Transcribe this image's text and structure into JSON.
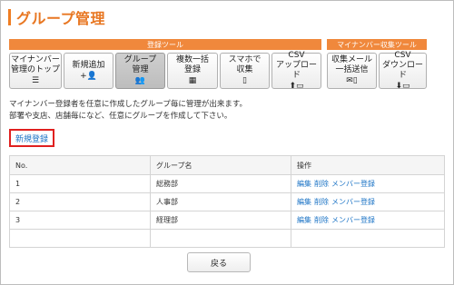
{
  "page": {
    "title": "グループ管理",
    "accent_color": "#ef7d22",
    "link_color": "#1c74c6",
    "highlight_color": "#e0201f"
  },
  "toolbar": {
    "registration_tools_label": "登録ツール",
    "mynumber_tools_label": "マイナンバー収集ツール",
    "buttons": [
      {
        "label": "マイナンバー\n管理のトップ",
        "icon": "list-icon",
        "glyph": "☰"
      },
      {
        "label": "新規追加",
        "icon": "add-user-icon",
        "glyph": "+👤"
      },
      {
        "label": "グループ\n管理",
        "icon": "users-icon",
        "glyph": "👥"
      },
      {
        "label": "複数一括\n登録",
        "icon": "grid-icon",
        "glyph": "▦"
      },
      {
        "label": "スマホで\n収集",
        "icon": "mobile-icon",
        "glyph": "▯"
      },
      {
        "label": "CSV\nアップロード",
        "icon": "upload-icon",
        "glyph": "⬆▭"
      },
      {
        "label": "収集メール\n一括送信",
        "icon": "mail-mobile-icon",
        "glyph": "✉▯"
      },
      {
        "label": "CSV\nダウンロード",
        "icon": "download-icon",
        "glyph": "⬇▭"
      }
    ]
  },
  "description": {
    "line1": "マイナンバー登録者を任意に作成したグループ毎に管理が出来ます。",
    "line2": "部署や支店、店舗毎になど、任意にグループを作成して下さい。"
  },
  "new_registration_label": "新規登録",
  "table": {
    "headers": {
      "no": "No.",
      "name": "グループ名",
      "ops": "操作"
    },
    "rows": [
      {
        "no": "1",
        "name": "総務部"
      },
      {
        "no": "2",
        "name": "人事部"
      },
      {
        "no": "3",
        "name": "経理部"
      }
    ],
    "actions": {
      "edit": "編集",
      "delete": "削除",
      "member": "メンバー登録"
    }
  },
  "back_label": "戻る"
}
